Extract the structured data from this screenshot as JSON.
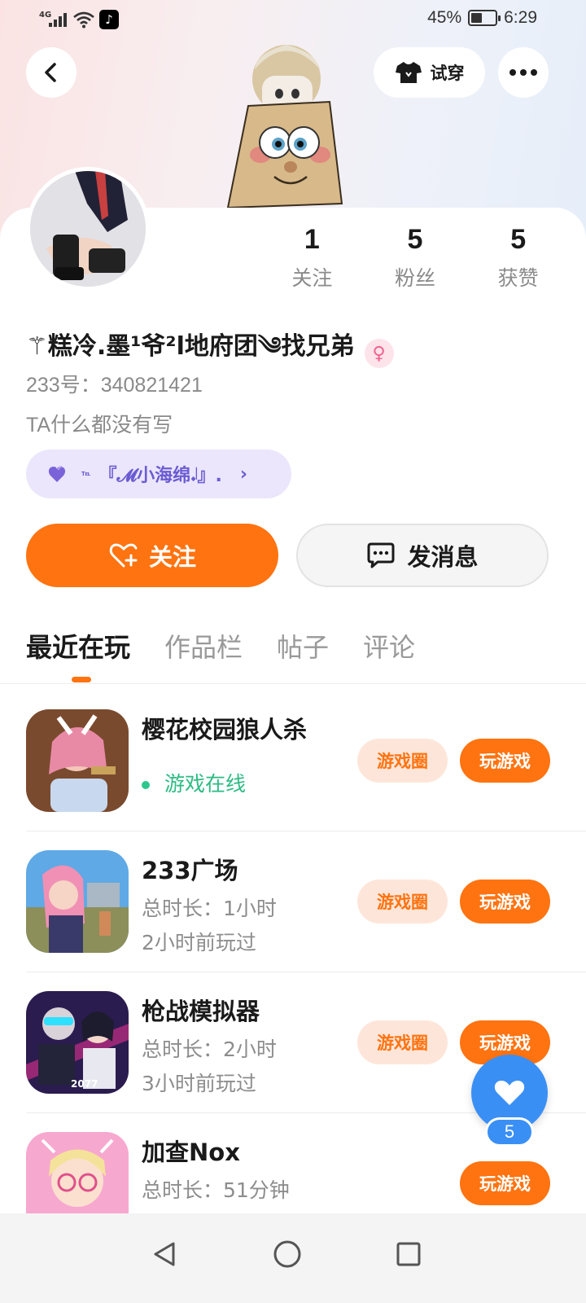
{
  "status_bar": {
    "network": "4G",
    "battery_percent": "45%",
    "battery_level": 0.45,
    "time": "6:29"
  },
  "header": {
    "back_icon": "chevron-left-icon",
    "try_on_label": "试穿",
    "try_on_icon": "tshirt-icon",
    "more_icon": "more-dots-icon"
  },
  "profile": {
    "stats": [
      {
        "value": "1",
        "label": "关注"
      },
      {
        "value": "5",
        "label": "粉丝"
      },
      {
        "value": "5",
        "label": "获赞"
      }
    ],
    "nickname": "⚚糕冷.墨¹爷²l地府团༄找兄弟",
    "gender_icon": "female-icon",
    "uid": "233号：340821421",
    "bio": "TA什么都没有写",
    "friend_tag": {
      "prefix": "℡",
      "label": "『𝓜小海绵𝆺𝅥』.",
      "icon": "heart-icon"
    },
    "follow_label": "关注",
    "message_label": "发消息"
  },
  "tabs": [
    {
      "label": "最近在玩",
      "active": true
    },
    {
      "label": "作品栏",
      "active": false
    },
    {
      "label": "帖子",
      "active": false
    },
    {
      "label": "评论",
      "active": false
    }
  ],
  "games": [
    {
      "name": "樱花校园狼人杀",
      "line1": "游戏在线",
      "online": true,
      "line2": "",
      "circle_label": "游戏圈",
      "play_label": "玩游戏",
      "has_circle": true
    },
    {
      "name": "233广场",
      "line1": "总时长：1小时",
      "online": false,
      "line2": "2小时前玩过",
      "circle_label": "游戏圈",
      "play_label": "玩游戏",
      "has_circle": true
    },
    {
      "name": "枪战模拟器",
      "line1": "总时长：2小时",
      "online": false,
      "line2": "3小时前玩过",
      "circle_label": "游戏圈",
      "play_label": "玩游戏",
      "has_circle": true
    },
    {
      "name": "加查Nox",
      "line1": "总时长：51分钟",
      "online": false,
      "line2": "",
      "circle_label": "",
      "play_label": "玩游戏",
      "has_circle": false
    }
  ],
  "like_fab": {
    "count": "5",
    "icon": "heart-icon"
  },
  "colors": {
    "accent": "#ff7310",
    "online_green": "#2dbb83",
    "like_blue": "#3a8ff5",
    "friend_purple": "#6a5bd2"
  }
}
